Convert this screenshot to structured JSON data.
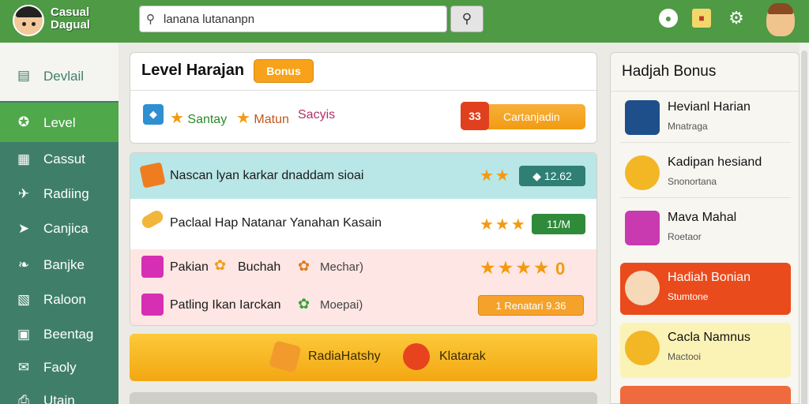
{
  "header": {
    "logo_text": "Casual Dagual",
    "search_value": "lanana lutananpn",
    "search_placeholder": ""
  },
  "sidebar": {
    "items": [
      {
        "label": "Devlail",
        "icon": "book-icon"
      },
      {
        "label": "Level",
        "icon": "star-badge-icon"
      },
      {
        "label": "Cassut",
        "icon": "chart-icon"
      },
      {
        "label": "Radiing",
        "icon": "plane-icon"
      },
      {
        "label": "Canjica",
        "icon": "rocket-icon"
      },
      {
        "label": "Banjke",
        "icon": "leaf-icon"
      },
      {
        "label": "Raloon",
        "icon": "map-icon"
      },
      {
        "label": "Beentag",
        "icon": "bag-icon"
      },
      {
        "label": "Faoly",
        "icon": "mail-icon"
      },
      {
        "label": "Utain",
        "icon": "printer-icon"
      }
    ]
  },
  "level_panel": {
    "title": "Level Harajan",
    "bonus_label": "Bonus",
    "tag1": "Santay",
    "tag2": "Matun",
    "tag3": "Sacyis",
    "cta_icon_text": "33",
    "cta_label": "Cartanjadin"
  },
  "rows": [
    {
      "text": "Nascan lyan karkar dnaddam sioai",
      "stars": "★★",
      "pill": "◆  12.62"
    },
    {
      "text": "Paclaal Hap Natanar Yanahan Kasain",
      "stars": "★★★",
      "pill": "11/M"
    },
    {
      "text": "Pakian",
      "text2": "Buchah",
      "extra": "Mechar)",
      "stars": "★★★★",
      "pill": "0"
    },
    {
      "text": "Patling Ikan Iarckan",
      "extra": "Moepai)",
      "stars": "",
      "pill": "1 Renatari 9.36"
    }
  ],
  "action_bar": {
    "left_label": "RadiaHatshy",
    "right_label": "Klatarak"
  },
  "rewards": {
    "title": "Hadjah Bonus",
    "items": [
      {
        "name": "Hevianl Harian",
        "sub": "Mnatraga"
      },
      {
        "name": "Kadipan hesiand",
        "sub": "Snonortana"
      },
      {
        "name": "Mava Mahal",
        "sub": "Roetaor"
      },
      {
        "name": "Hadiah Bonian",
        "sub": "Stumtone"
      },
      {
        "name": "Cacla Namnus",
        "sub": "Mactooi"
      }
    ]
  },
  "colors": {
    "topbar": "#4e9a45",
    "sidebar": "#3f7f6a",
    "accent_orange": "#f7a21a",
    "highlight_red": "#ea4b1c"
  }
}
